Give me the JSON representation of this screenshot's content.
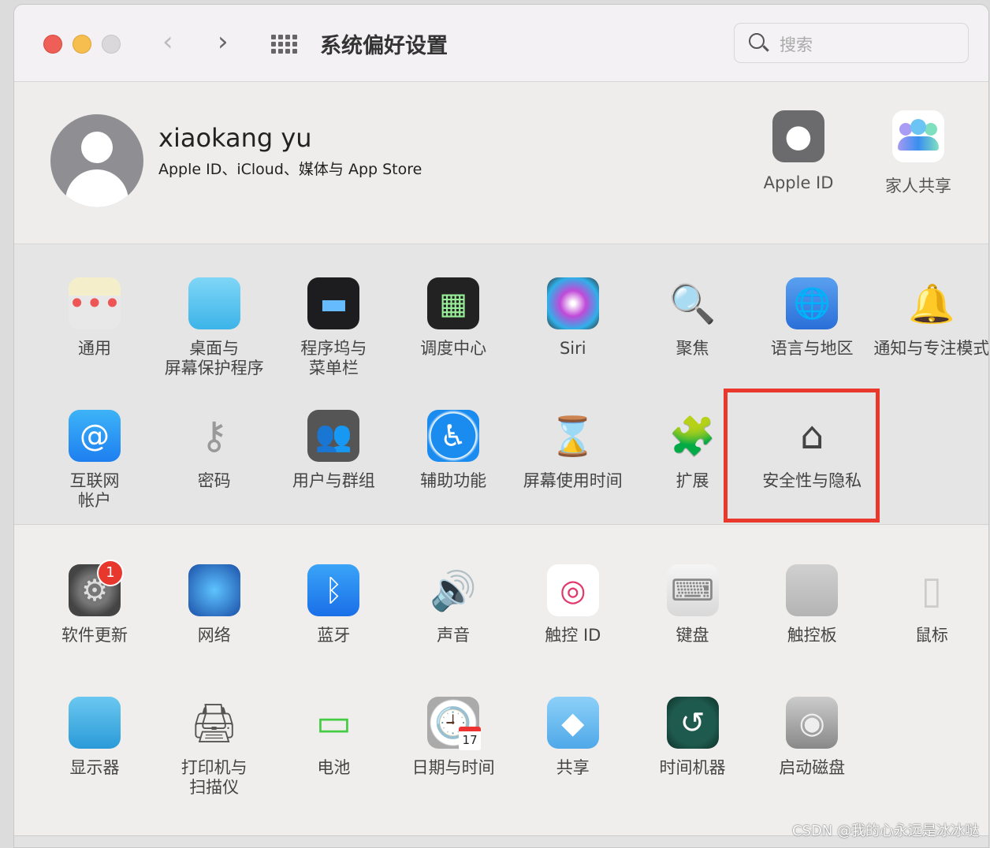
{
  "window": {
    "title": "系统偏好设置",
    "search_placeholder": "搜索"
  },
  "profile": {
    "name": "xiaokang yu",
    "subtitle": "Apple ID、iCloud、媒体与 App Store",
    "shortcuts": [
      {
        "label": "Apple ID",
        "icon": "apple-icon"
      },
      {
        "label": "家人共享",
        "icon": "family-sharing-icon"
      }
    ]
  },
  "sections": [
    {
      "items": [
        {
          "label": "通用",
          "icon": "general-icon"
        },
        {
          "label": "桌面与\n屏幕保护程序",
          "icon": "desktop-screensaver-icon"
        },
        {
          "label": "程序坞与\n菜单栏",
          "icon": "dock-menubar-icon"
        },
        {
          "label": "调度中心",
          "icon": "mission-control-icon"
        },
        {
          "label": "Siri",
          "icon": "siri-icon"
        },
        {
          "label": "聚焦",
          "icon": "spotlight-icon"
        },
        {
          "label": "语言与地区",
          "icon": "language-region-icon"
        },
        {
          "label": "通知与专注模式",
          "icon": "notifications-icon"
        },
        {
          "label": "互联网\n帐户",
          "icon": "internet-accounts-icon"
        },
        {
          "label": "密码",
          "icon": "passwords-key-icon"
        },
        {
          "label": "用户与群组",
          "icon": "users-groups-icon"
        },
        {
          "label": "辅助功能",
          "icon": "accessibility-icon"
        },
        {
          "label": "屏幕使用时间",
          "icon": "screen-time-hourglass-icon"
        },
        {
          "label": "扩展",
          "icon": "extensions-puzzle-icon"
        },
        {
          "label": "安全性与隐私",
          "icon": "security-privacy-icon",
          "highlighted": true
        }
      ]
    },
    {
      "items": [
        {
          "label": "软件更新",
          "icon": "software-update-gear-icon",
          "badge": "1"
        },
        {
          "label": "网络",
          "icon": "network-globe-icon"
        },
        {
          "label": "蓝牙",
          "icon": "bluetooth-icon"
        },
        {
          "label": "声音",
          "icon": "sound-speaker-icon"
        },
        {
          "label": "触控 ID",
          "icon": "touch-id-fingerprint-icon"
        },
        {
          "label": "键盘",
          "icon": "keyboard-icon"
        },
        {
          "label": "触控板",
          "icon": "trackpad-icon"
        },
        {
          "label": "鼠标",
          "icon": "mouse-icon"
        },
        {
          "label": "显示器",
          "icon": "display-icon"
        },
        {
          "label": "打印机与\n扫描仪",
          "icon": "printer-icon"
        },
        {
          "label": "电池",
          "icon": "battery-icon"
        },
        {
          "label": "日期与时间",
          "icon": "date-time-clock-icon",
          "calendar_text": "17"
        },
        {
          "label": "共享",
          "icon": "sharing-folder-icon"
        },
        {
          "label": "时间机器",
          "icon": "time-machine-icon"
        },
        {
          "label": "启动磁盘",
          "icon": "startup-disk-icon"
        }
      ]
    }
  ],
  "highlight_color": "#e9392d",
  "watermark": "CSDN @我的心永远是冰冰哒"
}
